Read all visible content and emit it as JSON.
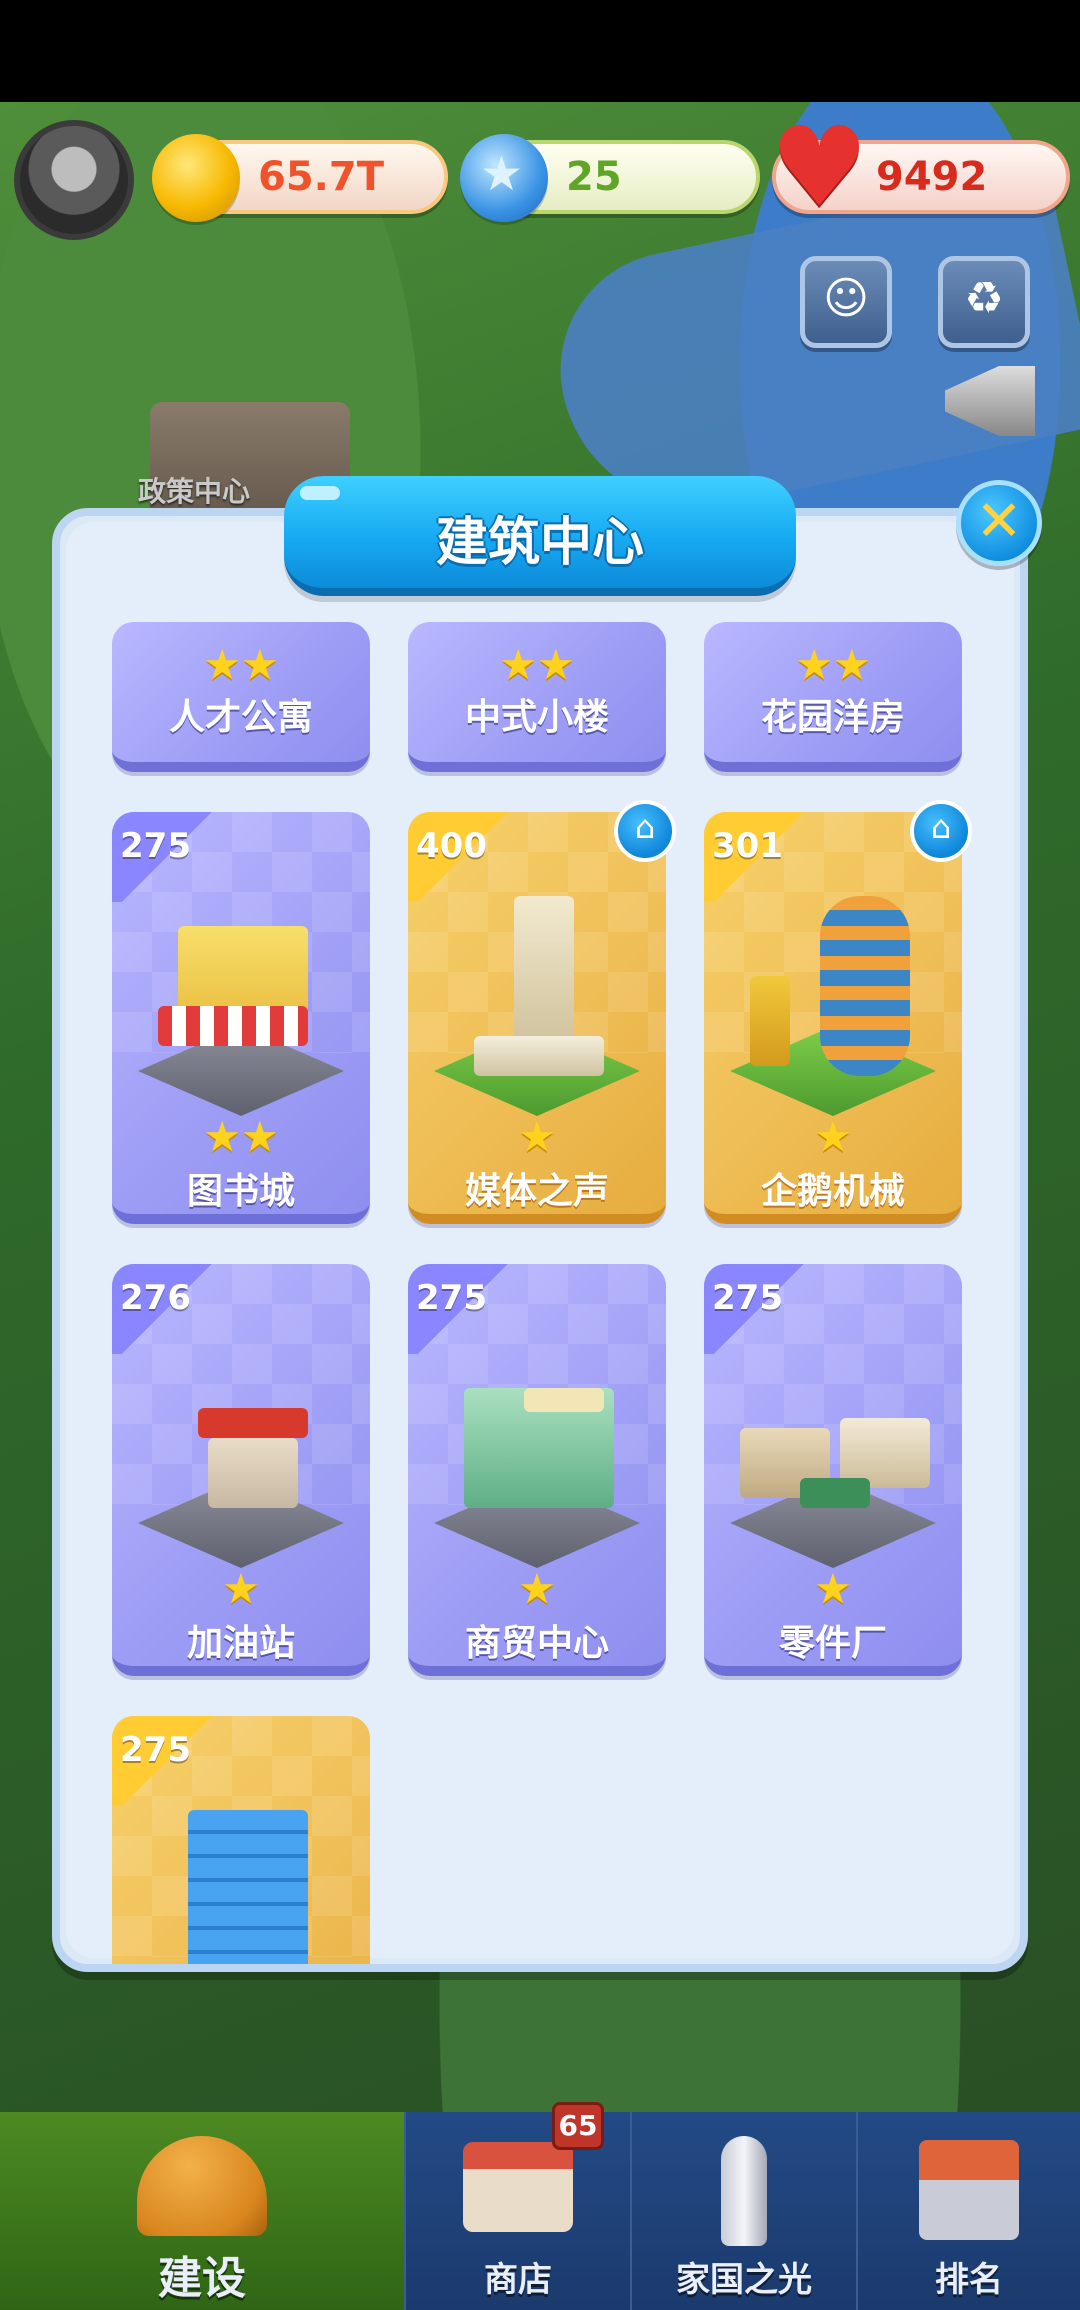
{
  "hud": {
    "coins": "65.7T",
    "gems": "25",
    "hearts": "9492",
    "icons": {
      "avatar": "player-avatar",
      "coin": "gold-coin-icon",
      "gem": "blue-star-gem-icon",
      "heart": "red-heart-icon",
      "event_left": "event-character-icon",
      "event_right": "recycle-event-icon",
      "megaphone": "megaphone-icon"
    }
  },
  "map": {
    "policy_center_label": "政策中心"
  },
  "modal": {
    "title": "建筑中心",
    "close_icon": "close-x-icon",
    "cards": [
      {
        "name": "人才公寓",
        "stars": "★★",
        "variant": "purple"
      },
      {
        "name": "中式小楼",
        "stars": "★★",
        "variant": "purple"
      },
      {
        "name": "花园洋房",
        "stars": "★★",
        "variant": "purple"
      },
      {
        "name": "图书城",
        "level": "275",
        "stars": "★★",
        "variant": "purple",
        "house": false
      },
      {
        "name": "媒体之声",
        "level": "400",
        "stars": "★",
        "variant": "gold",
        "house": true
      },
      {
        "name": "企鹅机械",
        "level": "301",
        "stars": "★",
        "variant": "gold",
        "house": true
      },
      {
        "name": "加油站",
        "level": "276",
        "stars": "★",
        "variant": "purple",
        "house": false
      },
      {
        "name": "商贸中心",
        "level": "275",
        "stars": "★",
        "variant": "purple",
        "house": false
      },
      {
        "name": "零件厂",
        "level": "275",
        "stars": "★",
        "variant": "purple",
        "house": false
      },
      {
        "level": "275",
        "variant": "gold",
        "house": false
      }
    ]
  },
  "bottom_nav": {
    "build": "建设",
    "shop": "商店",
    "shop_badge": "65",
    "light": "家国之光",
    "rank": "排名"
  },
  "colors": {
    "card_purple": "#9e9df5",
    "card_gold": "#efbe56",
    "title_blue": "#17aaf2",
    "nav_blue": "#1b3a6d",
    "nav_active_green": "#3f7a1d"
  }
}
